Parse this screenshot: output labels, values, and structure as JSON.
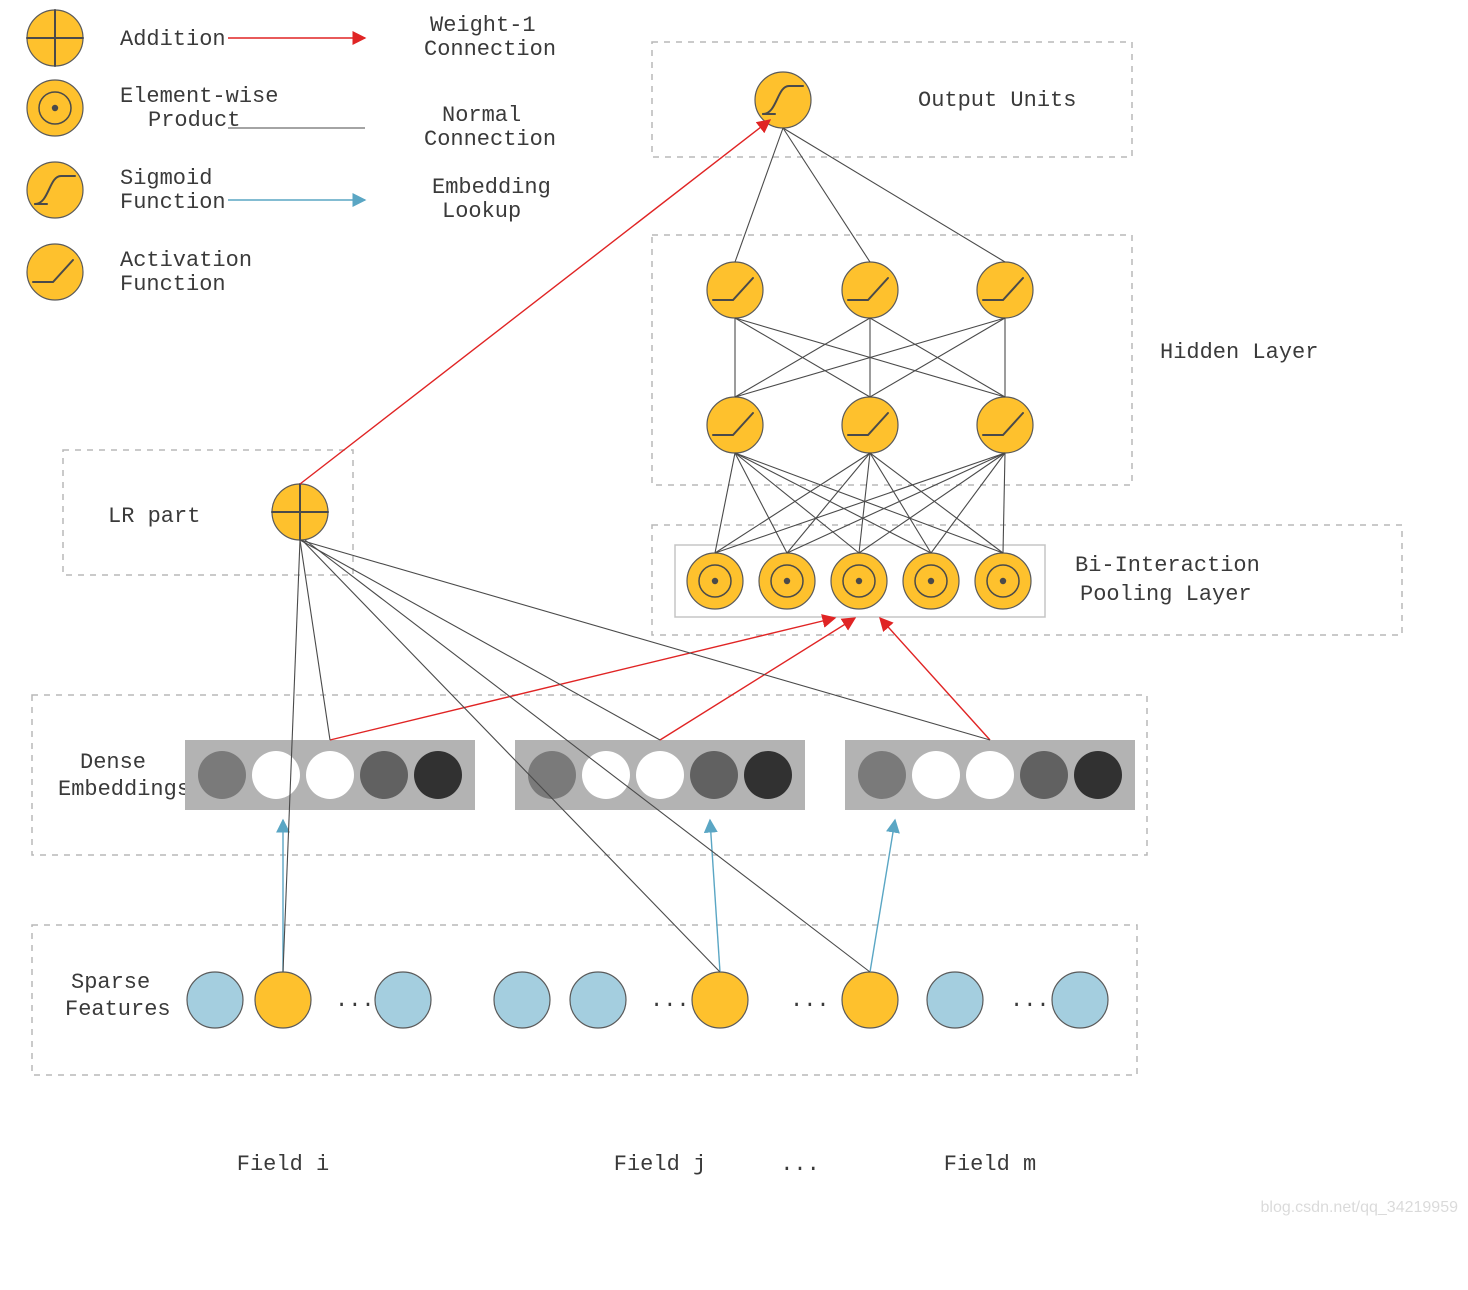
{
  "legend": {
    "addition": "Addition",
    "elementwise": "Element-wise\nProduct",
    "sigmoid": "Sigmoid\nFunction",
    "activation": "Activation\nFunction",
    "weight1": "Weight-1\nConnection",
    "normal": "Normal\nConnection",
    "embedding": "Embedding\nLookup"
  },
  "labels": {
    "output": "Output Units",
    "hidden": "Hidden Layer",
    "lr": "LR part",
    "bi": "Bi-Interaction\nPooling Layer",
    "dense": "Dense\nEmbeddings",
    "sparse": "Sparse\nFeatures",
    "field_i": "Field i",
    "field_j": "Field j",
    "field_m": "Field m",
    "dots": "...",
    "watermark": "blog.csdn.net/qq_34219959"
  },
  "diagram": {
    "embedding_groups": 3,
    "embedding_per_group": 5,
    "bi_pool_nodes": 5,
    "hidden_rows": 2,
    "hidden_cols": 3,
    "sparse_fields": 3
  }
}
